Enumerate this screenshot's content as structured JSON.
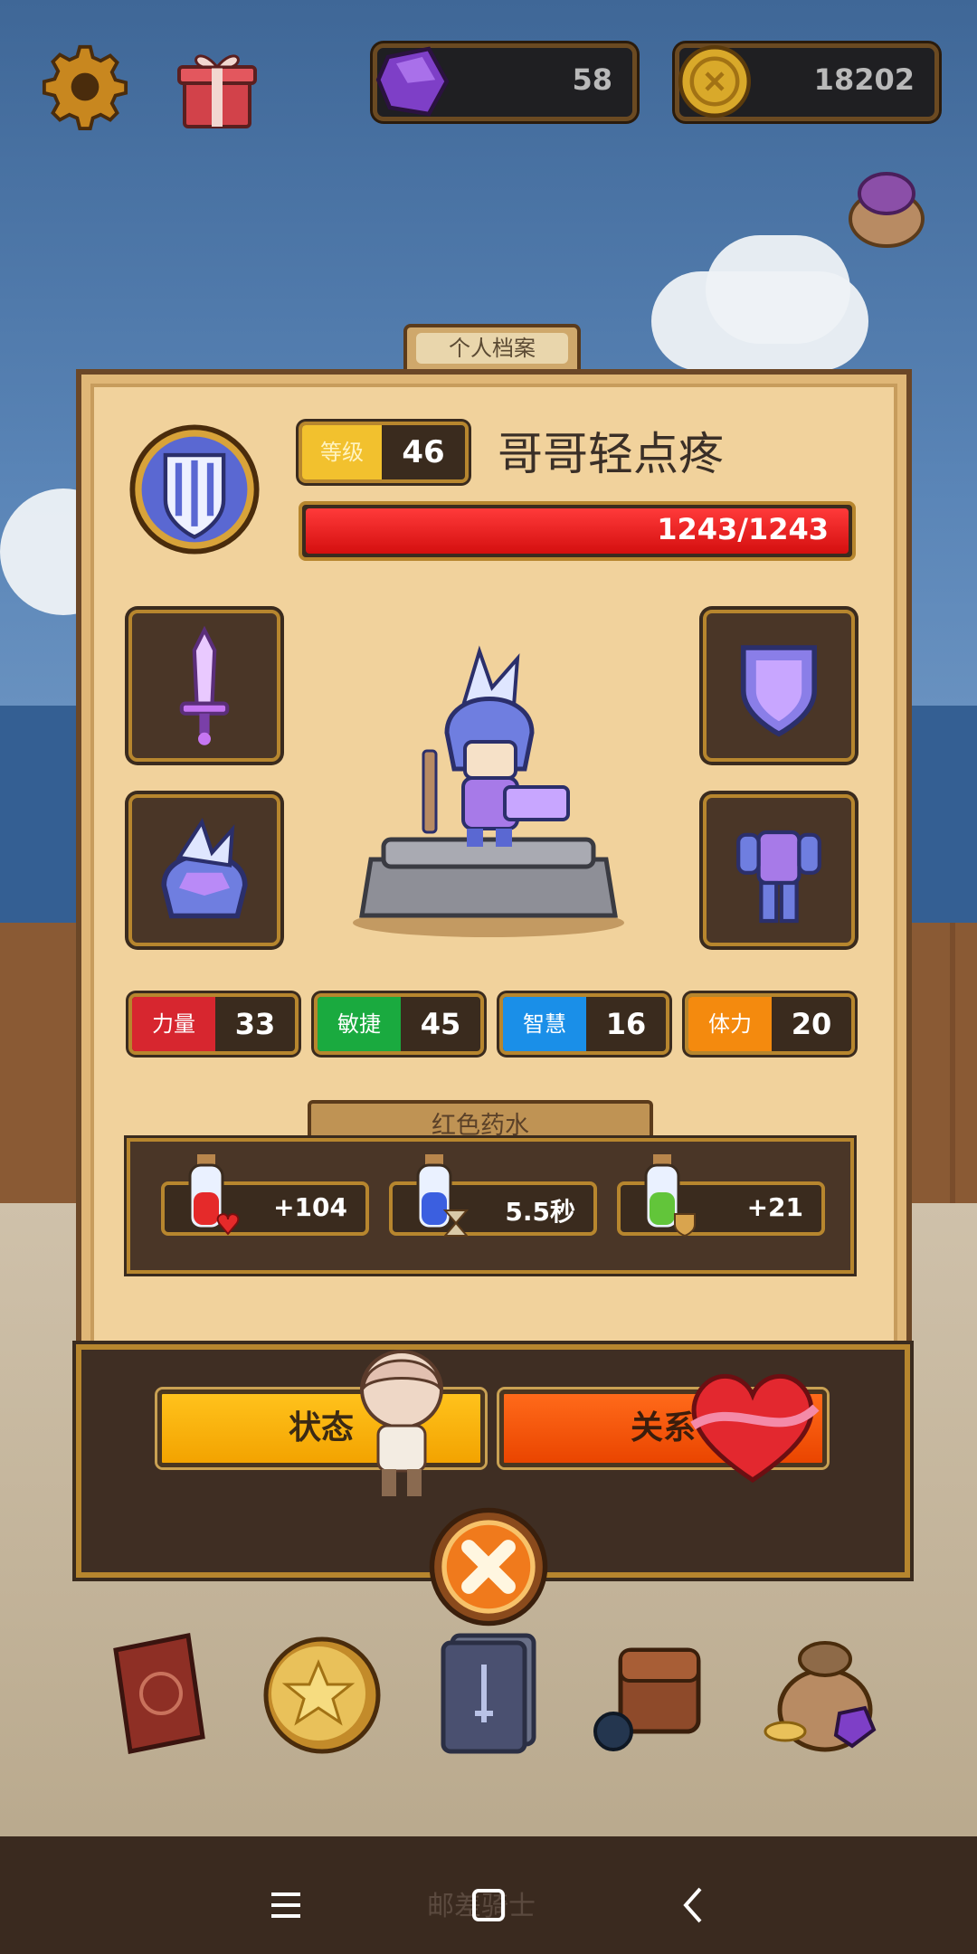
{
  "top_bar": {
    "gems": "58",
    "coins": "18202"
  },
  "profile_tab": "个人档案",
  "player": {
    "level_label": "等级",
    "level": "46",
    "name": "哥哥轻点疼",
    "hp_text": "1243/1243",
    "hp_fraction": 1.0
  },
  "equipment": [
    "sword",
    "shield",
    "helmet",
    "armor"
  ],
  "stats": [
    {
      "label": "力量",
      "value": "33",
      "color": "#d7262f"
    },
    {
      "label": "敏捷",
      "value": "45",
      "color": "#1aaa3f"
    },
    {
      "label": "智慧",
      "value": "16",
      "color": "#1a8fe8"
    },
    {
      "label": "体力",
      "value": "20",
      "color": "#f48a0e"
    }
  ],
  "potion": {
    "title": "红色药水",
    "items": [
      {
        "value": "+104",
        "icon": "red-potion-heart-icon"
      },
      {
        "value": "5.5秒",
        "icon": "blue-potion-hourglass-icon"
      },
      {
        "value": "+21",
        "icon": "green-potion-shield-icon"
      }
    ]
  },
  "buttons": {
    "status": "状态",
    "relation": "关系"
  },
  "bottom_menu": [
    "book-icon",
    "star-coin-icon",
    "card-deck-icon",
    "backpack-icon",
    "treasure-bag-icon"
  ],
  "nav_text": "邮差骑士"
}
